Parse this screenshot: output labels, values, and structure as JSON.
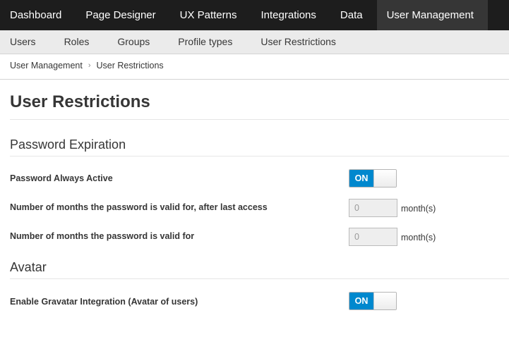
{
  "topnav": {
    "items": [
      "Dashboard",
      "Page Designer",
      "UX Patterns",
      "Integrations",
      "Data",
      "User Management"
    ],
    "active": "User Management"
  },
  "subnav": {
    "items": [
      "Users",
      "Roles",
      "Groups",
      "Profile types",
      "User Restrictions"
    ]
  },
  "breadcrumb": {
    "parent": "User Management",
    "current": "User Restrictions"
  },
  "page": {
    "title": "User Restrictions"
  },
  "password_section": {
    "title": "Password Expiration",
    "always_active_label": "Password Always Active",
    "always_active_toggle": "ON",
    "months_after_access_label": "Number of months the password is valid for, after last access",
    "months_after_access_value": "0",
    "months_after_access_unit": "month(s)",
    "months_valid_label": "Number of months the password is valid for",
    "months_valid_value": "0",
    "months_valid_unit": "month(s)"
  },
  "avatar_section": {
    "title": "Avatar",
    "gravatar_label": "Enable Gravatar Integration (Avatar of users)",
    "gravatar_toggle": "ON"
  },
  "colors": {
    "topnav_bg": "#1d1d1d",
    "topnav_active": "#363636",
    "toggle_on": "#0088ce"
  }
}
